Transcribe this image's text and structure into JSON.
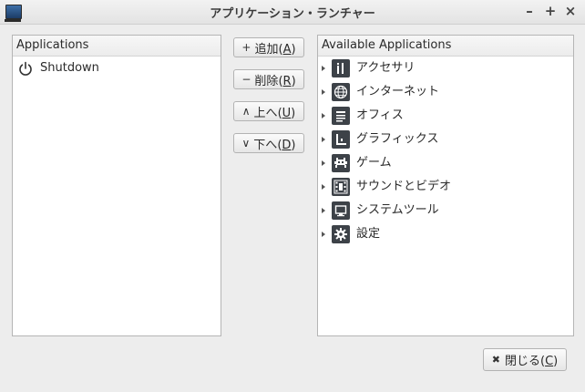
{
  "window": {
    "title": "アプリケーション・ランチャー",
    "minimize": "–",
    "maximize": "+",
    "close": "×"
  },
  "left_panel": {
    "header": "Applications",
    "items": [
      {
        "label": "Shutdown",
        "icon": "power-icon"
      }
    ]
  },
  "buttons": {
    "add": {
      "glyph": "+",
      "text": "追加",
      "mnemonic": "A"
    },
    "remove": {
      "glyph": "−",
      "text": "削除",
      "mnemonic": "R"
    },
    "up": {
      "glyph": "∧",
      "text": "上へ",
      "mnemonic": "U"
    },
    "down": {
      "glyph": "∨",
      "text": "下へ",
      "mnemonic": "D"
    }
  },
  "right_panel": {
    "header": "Available Applications",
    "categories": [
      {
        "label": "アクセサリ",
        "icon": "accessories-icon"
      },
      {
        "label": "インターネット",
        "icon": "globe-icon"
      },
      {
        "label": "オフィス",
        "icon": "document-icon"
      },
      {
        "label": "グラフィックス",
        "icon": "graphics-icon"
      },
      {
        "label": "ゲーム",
        "icon": "game-icon"
      },
      {
        "label": "サウンドとビデオ",
        "icon": "film-icon"
      },
      {
        "label": "システムツール",
        "icon": "monitor-icon"
      },
      {
        "label": "設定",
        "icon": "gear-icon"
      }
    ]
  },
  "footer": {
    "close": {
      "glyph": "✖",
      "text": "閉じる",
      "mnemonic": "C"
    }
  }
}
